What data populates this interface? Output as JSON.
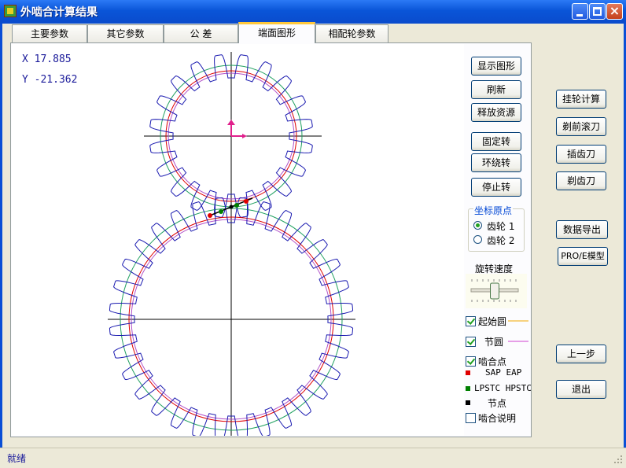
{
  "window": {
    "title": "外啮合计算结果",
    "close_glyph": "×"
  },
  "tabs": [
    "主要参数",
    "其它参数",
    "公  差",
    "端面图形",
    "相配轮参数"
  ],
  "active_tab_index": 3,
  "readout": {
    "x": "X 17.885",
    "y": "Y -21.362"
  },
  "graph_buttons": [
    "显示图形",
    "刷新",
    "释放资源",
    "固定转",
    "环绕转",
    "停止转"
  ],
  "origin_group": {
    "label": "坐标原点",
    "options": [
      "齿轮 1",
      "齿轮 2"
    ],
    "selected_index": 0
  },
  "speed": {
    "label": "旋转速度",
    "level": 0.5
  },
  "layers": {
    "base_circle": {
      "label": "起始圆",
      "checked": true,
      "line_color": "#f2a800"
    },
    "pitch_circle": {
      "label": "节圆",
      "checked": true,
      "line_color": "#d040d0"
    },
    "mesh_points": {
      "label": "啮合点",
      "checked": true
    },
    "mesh_notes": {
      "label": "啮合说明",
      "checked": false
    }
  },
  "legend": [
    {
      "label": "SAP EAP",
      "color": "#e00000"
    },
    {
      "label": "LPSTC HPSTC",
      "color": "#008000"
    },
    {
      "label": "节点",
      "color": "#000000"
    }
  ],
  "side_buttons": {
    "gear_train": "挂轮计算",
    "shaving_hob": "剃前滚刀",
    "shaper": "插齿刀",
    "shaving_cutter": "剃齿刀",
    "data_export": "数据导出",
    "proe_model": "PRO/E模型",
    "previous": "上一步",
    "exit": "退出"
  },
  "status": "就绪",
  "colors": {
    "tooth_profile": "#1a1ab0",
    "pitch": "#e00000",
    "addendum": "#20a060",
    "axis": "#000000",
    "origin_marker": "#e0208c"
  }
}
